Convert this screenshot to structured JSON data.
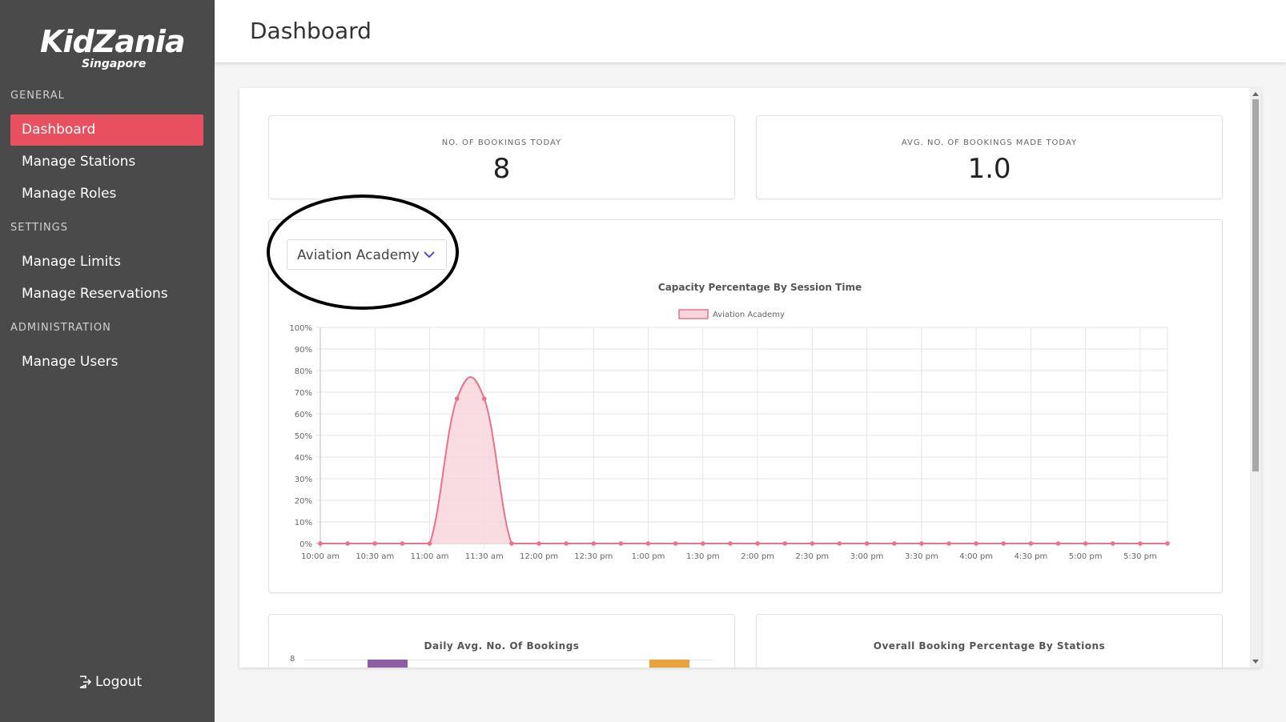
{
  "app": {
    "logo_main": "KidZania",
    "logo_sub": "Singapore",
    "accent": "#e8505f"
  },
  "sidebar": {
    "sections": [
      {
        "label": "GENERAL",
        "items": [
          "Dashboard",
          "Manage Stations",
          "Manage Roles"
        ]
      },
      {
        "label": "SETTINGS",
        "items": [
          "Manage Limits",
          "Manage Reservations"
        ]
      },
      {
        "label": "ADMINISTRATION",
        "items": [
          "Manage Users"
        ]
      }
    ],
    "general_label": "GENERAL",
    "settings_label": "SETTINGS",
    "administration_label": "ADMINISTRATION",
    "dashboard": "Dashboard",
    "manage_stations": "Manage Stations",
    "manage_roles": "Manage Roles",
    "manage_limits": "Manage Limits",
    "manage_reservations": "Manage Reservations",
    "manage_users": "Manage Users",
    "active_item": "Dashboard",
    "logout": "Logout",
    "logout_icon": "logout-icon"
  },
  "header": {
    "title": "Dashboard"
  },
  "stats": {
    "bookings_today_label": "NO. OF BOOKINGS TODAY",
    "bookings_today_value": "8",
    "avg_bookings_label": "AVG. NO. OF BOOKINGS MADE TODAY",
    "avg_bookings_value": "1.0"
  },
  "station_select": {
    "value": "Aviation Academy",
    "icon": "chevron-down-icon"
  },
  "bottom_cards": {
    "daily_avg_title": "Daily Avg. No. Of Bookings",
    "daily_avg_tick": "8",
    "overall_title": "Overall Booking Percentage By Stations"
  },
  "chart_data": [
    {
      "type": "area",
      "title": "Capacity Percentage By Session Time",
      "x": [
        "10:00 am",
        "10:15 am",
        "10:30 am",
        "10:45 am",
        "11:00 am",
        "11:15 am",
        "11:30 am",
        "11:45 am",
        "12:00 pm",
        "12:15 pm",
        "12:30 pm",
        "12:45 pm",
        "1:00 pm",
        "1:15 pm",
        "1:30 pm",
        "1:45 pm",
        "2:00 pm",
        "2:15 pm",
        "2:30 pm",
        "2:45 pm",
        "3:00 pm",
        "3:15 pm",
        "3:30 pm",
        "3:45 pm",
        "4:00 pm",
        "4:15 pm",
        "4:30 pm",
        "4:45 pm",
        "5:00 pm",
        "5:15 pm",
        "5:30 pm",
        "5:45 pm"
      ],
      "tick_labels": [
        "10:00 am",
        "10:30 am",
        "11:00 am",
        "11:30 am",
        "12:00 pm",
        "12:30 pm",
        "1:00 pm",
        "1:30 pm",
        "2:00 pm",
        "2:30 pm",
        "3:00 pm",
        "3:30 pm",
        "4:00 pm",
        "4:30 pm",
        "5:00 pm",
        "5:30 pm"
      ],
      "y_ticks": [
        "0%",
        "10%",
        "20%",
        "30%",
        "40%",
        "50%",
        "60%",
        "70%",
        "80%",
        "90%",
        "100%"
      ],
      "series": [
        {
          "name": "Aviation Academy",
          "values": [
            0,
            0,
            0,
            0,
            0,
            67,
            67,
            0,
            0,
            0,
            0,
            0,
            0,
            0,
            0,
            0,
            0,
            0,
            0,
            0,
            0,
            0,
            0,
            0,
            0,
            0,
            0,
            0,
            0,
            0,
            0,
            0
          ]
        }
      ],
      "ylim": [
        0,
        100
      ],
      "grid": true,
      "legend": "top",
      "line_color": "#e8738a",
      "fill_color": "#f7d6dd"
    },
    {
      "type": "bar",
      "title": "Daily Avg. No. Of Bookings",
      "y_ticks": [
        "8"
      ],
      "bar_colors": [
        "#8e5ea2",
        "#e8a33d"
      ]
    }
  ]
}
